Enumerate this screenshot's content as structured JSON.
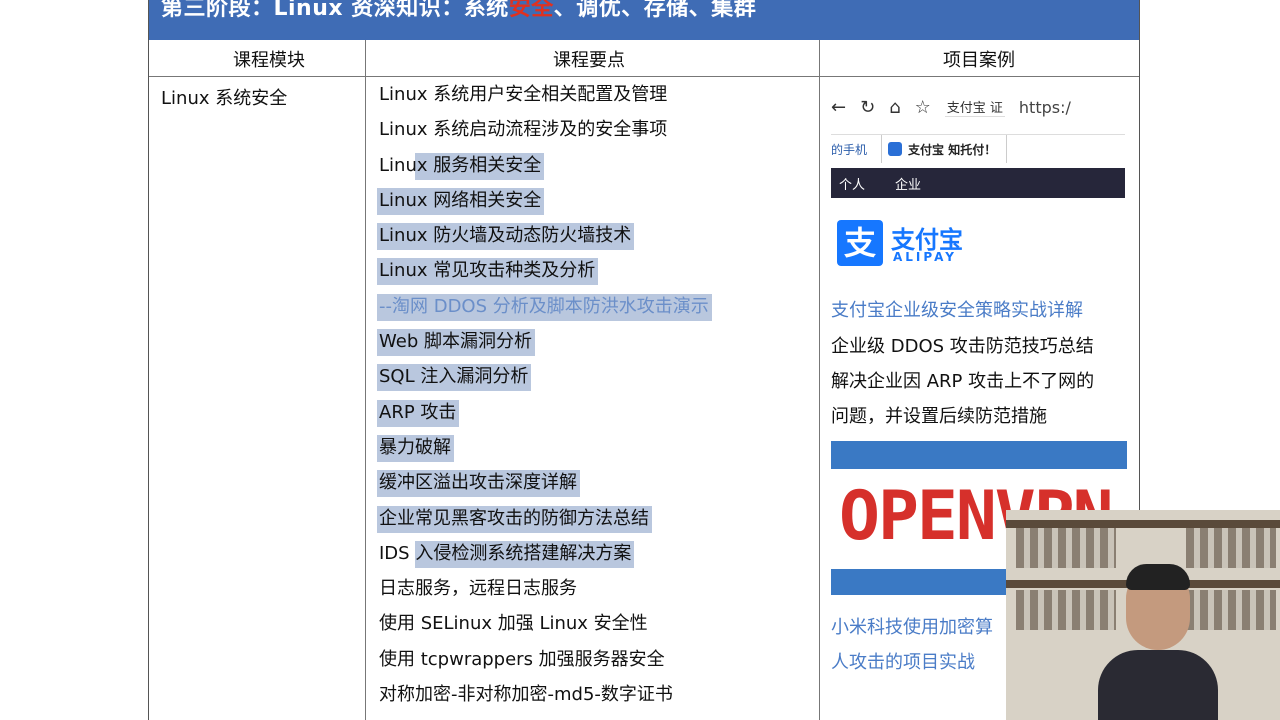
{
  "banner": {
    "prefix": "第三阶段：Linux 资深知识：系统",
    "highlight": "安全",
    "suffix": "、调优、存储、集群"
  },
  "table": {
    "headers": [
      "课程模块",
      "课程要点",
      "项目案例"
    ],
    "module": "Linux 系统安全",
    "points": [
      {
        "text": "Linux 系统用户安全相关配置及管理",
        "style": "plain"
      },
      {
        "text": "Linux 系统启动流程涉及的安全事项",
        "style": "plain"
      },
      {
        "text": "Linux 服务相关安全",
        "style": "partial"
      },
      {
        "text": "Linux 网络相关安全",
        "style": "selected"
      },
      {
        "text": "Linux 防火墙及动态防火墙技术",
        "style": "selected"
      },
      {
        "text": "Linux 常见攻击种类及分析",
        "style": "selected"
      },
      {
        "text": "--淘网 DDOS 分析及脚本防洪水攻击演示",
        "style": "selected-blue"
      },
      {
        "text": "Web 脚本漏洞分析",
        "style": "selected"
      },
      {
        "text": "SQL 注入漏洞分析",
        "style": "selected"
      },
      {
        "text": "ARP 攻击",
        "style": "selected"
      },
      {
        "text": "暴力破解",
        "style": "selected"
      },
      {
        "text": "缓冲区溢出攻击深度详解",
        "style": "selected"
      },
      {
        "text": "企业常见黑客攻击的防御方法总结",
        "style": "selected"
      },
      {
        "text": "IDS 入侵检测系统搭建解决方案",
        "style": "partial"
      },
      {
        "text": "日志服务，远程日志服务",
        "style": "plain"
      },
      {
        "text": "使用 SELinux 加强 Linux 安全性",
        "style": "plain"
      },
      {
        "text": "使用 tcpwrappers 加强服务器安全",
        "style": "plain"
      },
      {
        "text": "对称加密-非对称加密-md5-数字证书",
        "style": "plain"
      }
    ]
  },
  "browser": {
    "site_label": "支付宝 证",
    "url_text": "https:/",
    "tab1": "的手机",
    "tab2": "支付宝 知托付！",
    "nav_personal": "个人",
    "nav_enterprise": "企业"
  },
  "alipay_logo": {
    "glyph": "支",
    "cn": "支付宝",
    "en": "ALIPAY"
  },
  "cases": {
    "c1": "支付宝企业级安全策略实战详解",
    "c2": "企业级 DDOS 攻击防范技巧总结",
    "c3_line1": "解决企业因 ARP 攻击上不了网的",
    "c3_line2": "问题，并设置后续防范措施",
    "openvpn_word": "OPENVPN",
    "c4_line1": "小米科技使用加密算",
    "c4_line2": "人攻击的项目实战"
  },
  "colors": {
    "banner_bg": "#3f6cb5",
    "highlight": "#e0311f",
    "selection": "#b9c7de",
    "link_blue": "#4a7cc7",
    "alipay_blue": "#1677ff",
    "openvpn_red": "#d6302b"
  }
}
